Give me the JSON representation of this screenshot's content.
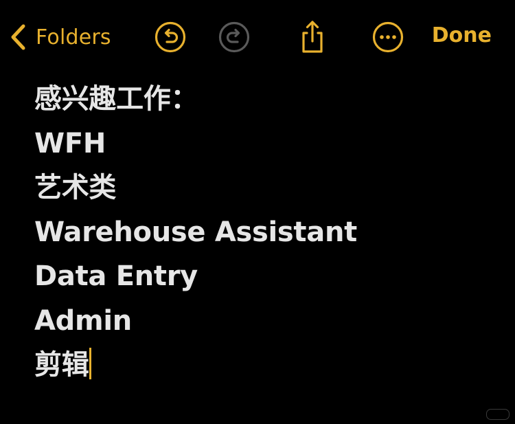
{
  "toolbar": {
    "back_label": "Folders",
    "icons": {
      "back": "chevron-left-icon",
      "undo": "undo-icon",
      "redo": "redo-icon",
      "share": "share-icon",
      "more": "more-icon"
    },
    "done_label": "Done"
  },
  "note": {
    "lines": [
      "感兴趣工作：",
      "WFH",
      "艺术类",
      "Warehouse Assistant",
      "Data Entry",
      "Admin",
      "剪辑"
    ]
  },
  "colors": {
    "accent": "#E8B12E",
    "text": "#E6E6E6",
    "background": "#000000",
    "disabled_icon": "#5A5A5A"
  }
}
